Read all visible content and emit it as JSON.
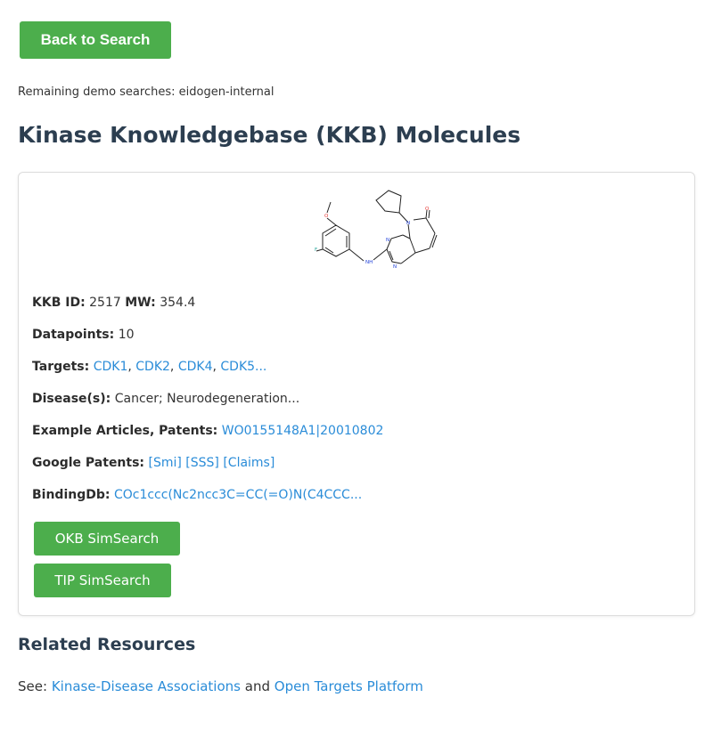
{
  "back_button": "Back to Search",
  "remaining": "Remaining demo searches: eidogen-internal",
  "page_title": "Kinase Knowledgebase (KKB) Molecules",
  "molecule": {
    "kkb_id_label": "KKB ID:",
    "kkb_id": "2517",
    "mw_label": "MW:",
    "mw": "354.4",
    "datapoints_label": "Datapoints:",
    "datapoints": "10",
    "targets_label": "Targets:",
    "targets": [
      "CDK1",
      "CDK2",
      "CDK4",
      "CDK5..."
    ],
    "disease_label": "Disease(s):",
    "disease": "Cancer; Neurodegeneration...",
    "articles_label": "Example Articles, Patents:",
    "article": "WO0155148A1|20010802",
    "google_label": "Google Patents:",
    "google_links": [
      "[Smi]",
      "[SSS]",
      "[Claims]"
    ],
    "bindingdb_label": "BindingDb:",
    "bindingdb": "COc1ccc(Nc2ncc3C=CC(=O)N(C4CCC...",
    "structure_atoms": {
      "o": "O",
      "f": "F",
      "nh": "NH",
      "n": "N",
      "o2": "O"
    }
  },
  "buttons": {
    "okb": "OKB SimSearch",
    "tip": "TIP SimSearch"
  },
  "related": {
    "title": "Related Resources",
    "see": "See:",
    "link1": "Kinase-Disease Associations",
    "and": "and",
    "link2": "Open Targets Platform"
  },
  "colors": {
    "green": "#4cae4c",
    "link": "#2a8cd8",
    "heading": "#2c3e50"
  }
}
